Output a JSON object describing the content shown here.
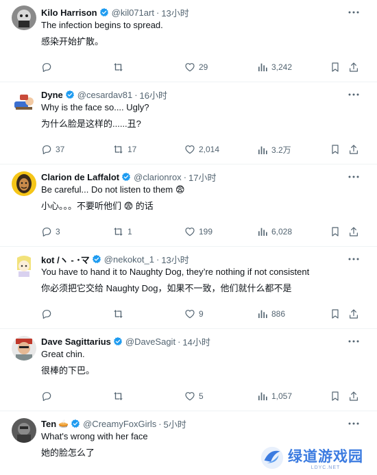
{
  "replies": [
    {
      "name": "Kilo Harrison",
      "emoji": "",
      "handle": "@kil071art",
      "separator": "·",
      "time": "13小时",
      "text_en": "The infection begins to spread.",
      "text_zh": "感染开始扩散。",
      "stats": {
        "replies": "",
        "retweets": "",
        "likes": "29",
        "views": "3,242"
      }
    },
    {
      "name": "Dyne",
      "emoji": "",
      "handle": "@cesardav81",
      "separator": "·",
      "time": "16小时",
      "text_en": "Why is the face so.... Ugly?",
      "text_zh": "为什么脸是这样的......丑?",
      "stats": {
        "replies": "37",
        "retweets": "17",
        "likes": "2,014",
        "views": "3.2万"
      }
    },
    {
      "name": "Clarion de Laffalot",
      "emoji": "",
      "handle": "@clarionrox",
      "separator": "·",
      "time": "17小时",
      "text_en": "Be careful... Do not listen to them 😨",
      "text_zh": "小心。。。不要听他们 😨 的话",
      "stats": {
        "replies": "3",
        "retweets": "1",
        "likes": "199",
        "views": "6,028"
      }
    },
    {
      "name": "kot /ヽ - ･マ",
      "emoji": "",
      "handle": "@nekokot_1",
      "separator": "·",
      "time": "13小时",
      "text_en": "You have to hand it to Naughty Dog, they’re nothing if not consistent",
      "text_zh": "你必须把它交给 Naughty Dog，如果不一致，他们就什么都不是",
      "stats": {
        "replies": "",
        "retweets": "",
        "likes": "9",
        "views": "886"
      }
    },
    {
      "name": "Dave Sagittarius",
      "emoji": "",
      "handle": "@DaveSagit",
      "separator": "·",
      "time": "14小时",
      "text_en": "Great chin.",
      "text_zh": "很棒的下巴。",
      "stats": {
        "replies": "",
        "retweets": "",
        "likes": "5",
        "views": "1,057"
      }
    },
    {
      "name": "Ten",
      "emoji": "🥧",
      "handle": "@CreamyFoxGirls",
      "separator": "·",
      "time": "5小时",
      "text_en": "What's wrong with her face",
      "text_zh": "她的脸怎么了",
      "stats": {
        "replies": "",
        "retweets": "",
        "likes": "",
        "views": ""
      }
    }
  ],
  "colors": {
    "accent": "#1d9bf0",
    "muted": "#536471",
    "text": "#0f1419",
    "divider": "#eff3f4"
  },
  "icons": [
    "verified-badge-icon",
    "more-icon",
    "reply-icon",
    "retweet-icon",
    "like-icon",
    "views-icon",
    "bookmark-icon",
    "share-icon"
  ],
  "watermark": {
    "title": "绿道游戏园",
    "subtitle": "LDYC.NET"
  }
}
